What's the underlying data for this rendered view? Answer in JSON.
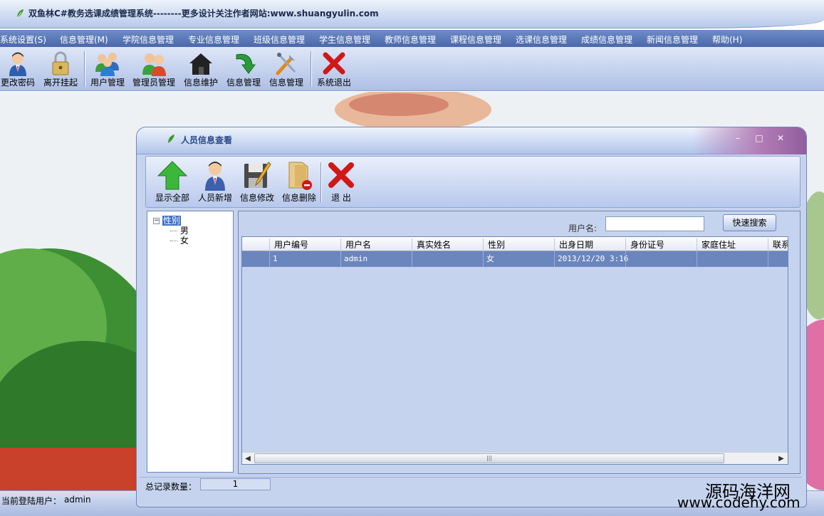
{
  "app": {
    "title": "双鱼林C#教务选课成绩管理系统--------更多设计关注作者网站:www.shuangyulin.com"
  },
  "menu": [
    {
      "label": "系统设置(S)"
    },
    {
      "label": "信息管理(M)"
    },
    {
      "label": "学院信息管理"
    },
    {
      "label": "专业信息管理"
    },
    {
      "label": "班级信息管理"
    },
    {
      "label": "学生信息管理"
    },
    {
      "label": "教师信息管理"
    },
    {
      "label": "课程信息管理"
    },
    {
      "label": "选课信息管理"
    },
    {
      "label": "成绩信息管理"
    },
    {
      "label": "新闻信息管理"
    },
    {
      "label": "帮助(H)"
    }
  ],
  "toolbar": [
    {
      "label": "更改密码",
      "icon": "user-icon"
    },
    {
      "label": "离开挂起",
      "icon": "lock-icon"
    },
    {
      "label": "用户管理",
      "icon": "users-icon"
    },
    {
      "label": "管理员管理",
      "icon": "admin-users-icon"
    },
    {
      "label": "信息维护",
      "icon": "home-icon"
    },
    {
      "label": "信息管理",
      "icon": "refresh-arrow-icon"
    },
    {
      "label": "信息管理",
      "icon": "tools-icon"
    },
    {
      "label": "系统退出",
      "icon": "exit-x-icon"
    }
  ],
  "dialog": {
    "title": "人员信息查看",
    "toolbar": [
      {
        "label": "显示全部",
        "icon": "up-arrow-icon"
      },
      {
        "label": "人员新增",
        "icon": "user-icon"
      },
      {
        "label": "信息修改",
        "icon": "save-edit-icon"
      },
      {
        "label": "信息删除",
        "icon": "folder-delete-icon"
      },
      {
        "label": "退 出",
        "icon": "exit-x-icon"
      }
    ],
    "tree": {
      "root": "性别",
      "children": [
        "男",
        "女"
      ]
    },
    "search": {
      "label": "用户名:",
      "value": "",
      "button": "快速搜索"
    },
    "grid": {
      "columns": [
        "用户编号",
        "用户名",
        "真实姓名",
        "性别",
        "出身日期",
        "身份证号",
        "家庭住址",
        "联系"
      ],
      "rows": [
        {
          "id": "1",
          "username": "admin",
          "realname": "",
          "gender": "女",
          "birthday": "2013/12/20 3:16",
          "idcard": "",
          "address": "",
          "contact": ""
        }
      ]
    },
    "count": {
      "label": "总记录数量：",
      "value": "1"
    }
  },
  "status": {
    "label": "当前登陆用户：",
    "user": "admin"
  },
  "watermark": {
    "line1": "源码海洋网",
    "line2": "www.codehy.com"
  },
  "colors": {
    "menubar": "#5b78b8",
    "selection": "#6b85bd",
    "dialog_bg": "#c5d3ee"
  }
}
